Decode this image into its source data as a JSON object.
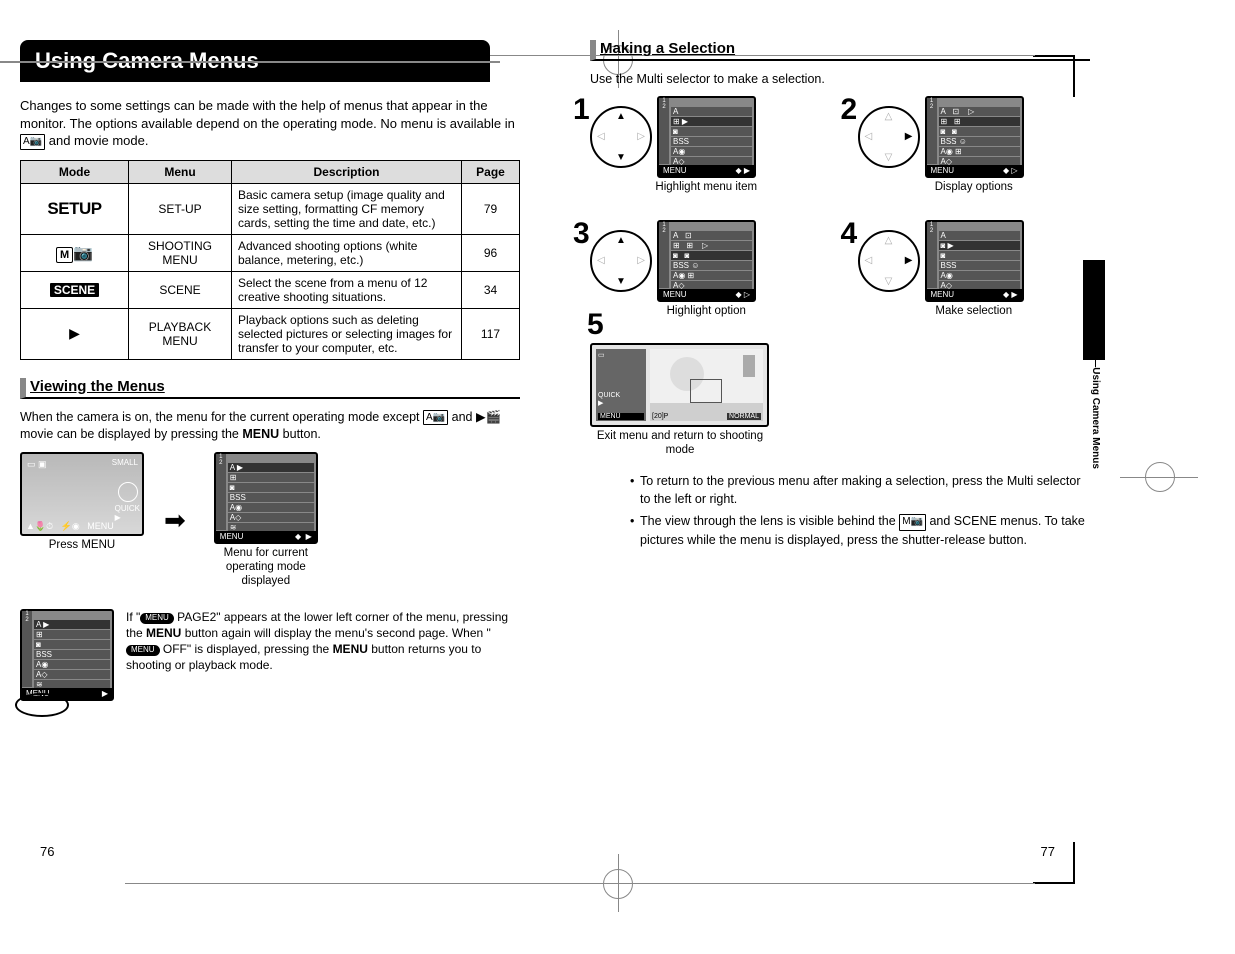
{
  "title": "Using Camera Menus",
  "intro": "Changes to some settings can be made with the help of menus that appear in the monitor. The options available depend on the operating mode. No menu is available in",
  "intro_tail": "and movie mode.",
  "table": {
    "headers": [
      "Mode",
      "Menu",
      "Description",
      "Page"
    ],
    "rows": [
      {
        "mode": "SETUP",
        "menu": "SET-UP",
        "desc": "Basic camera setup (image quality and size setting, formatting CF memory cards, setting the time and date, etc.)",
        "page": "79"
      },
      {
        "mode": "M",
        "menu": "SHOOTING MENU",
        "desc": "Advanced shooting options (white balance, metering, etc.)",
        "page": "96"
      },
      {
        "mode": "SCENE",
        "menu": "SCENE",
        "desc": "Select the scene from a menu of 12 creative shooting situations.",
        "page": "34"
      },
      {
        "mode": "▶",
        "menu": "PLAYBACK MENU",
        "desc": "Playback options such as deleting selected pictures or selecting images for transfer to your computer, etc.",
        "page": "117"
      }
    ]
  },
  "sec1": "Viewing the Menus",
  "view_text_1": "When the camera is on, the menu for the current operating mode except",
  "view_text_2": "and",
  "view_text_3": "movie can be displayed by pressing the",
  "menu_word": "MENU",
  "view_text_4": "button.",
  "cap_press": "Press MENU",
  "cap_menu_mode": "Menu for current operating mode displayed",
  "page2_text": {
    "p1": "If \"",
    "p2": " PAGE2\" appears at the lower left corner of the menu, pressing the ",
    "p3": " button again will display the menu's second page. When \"",
    "p4": " OFF\" is displayed, pressing the ",
    "p5": " button returns you to shooting or playback mode."
  },
  "sec2": "Making a Selection",
  "sec2_sub": "Use the Multi selector to make a selection.",
  "steps": {
    "s1": "Highlight menu item",
    "s2": "Display options",
    "s3": "Highlight option",
    "s4": "Make selection",
    "s5": "Exit menu and return to shooting mode"
  },
  "notes": [
    "To return to the previous menu after making a selection, press the Multi selector to the left or right.",
    "The view through the lens is visible behind the M📷 and SCENE menus. To take pictures while the menu is displayed, press the shutter-release button."
  ],
  "side_tab": "Menu Guide—Using Camera Menus",
  "page_left": "76",
  "page_right": "77",
  "menu_bar": "MENU"
}
